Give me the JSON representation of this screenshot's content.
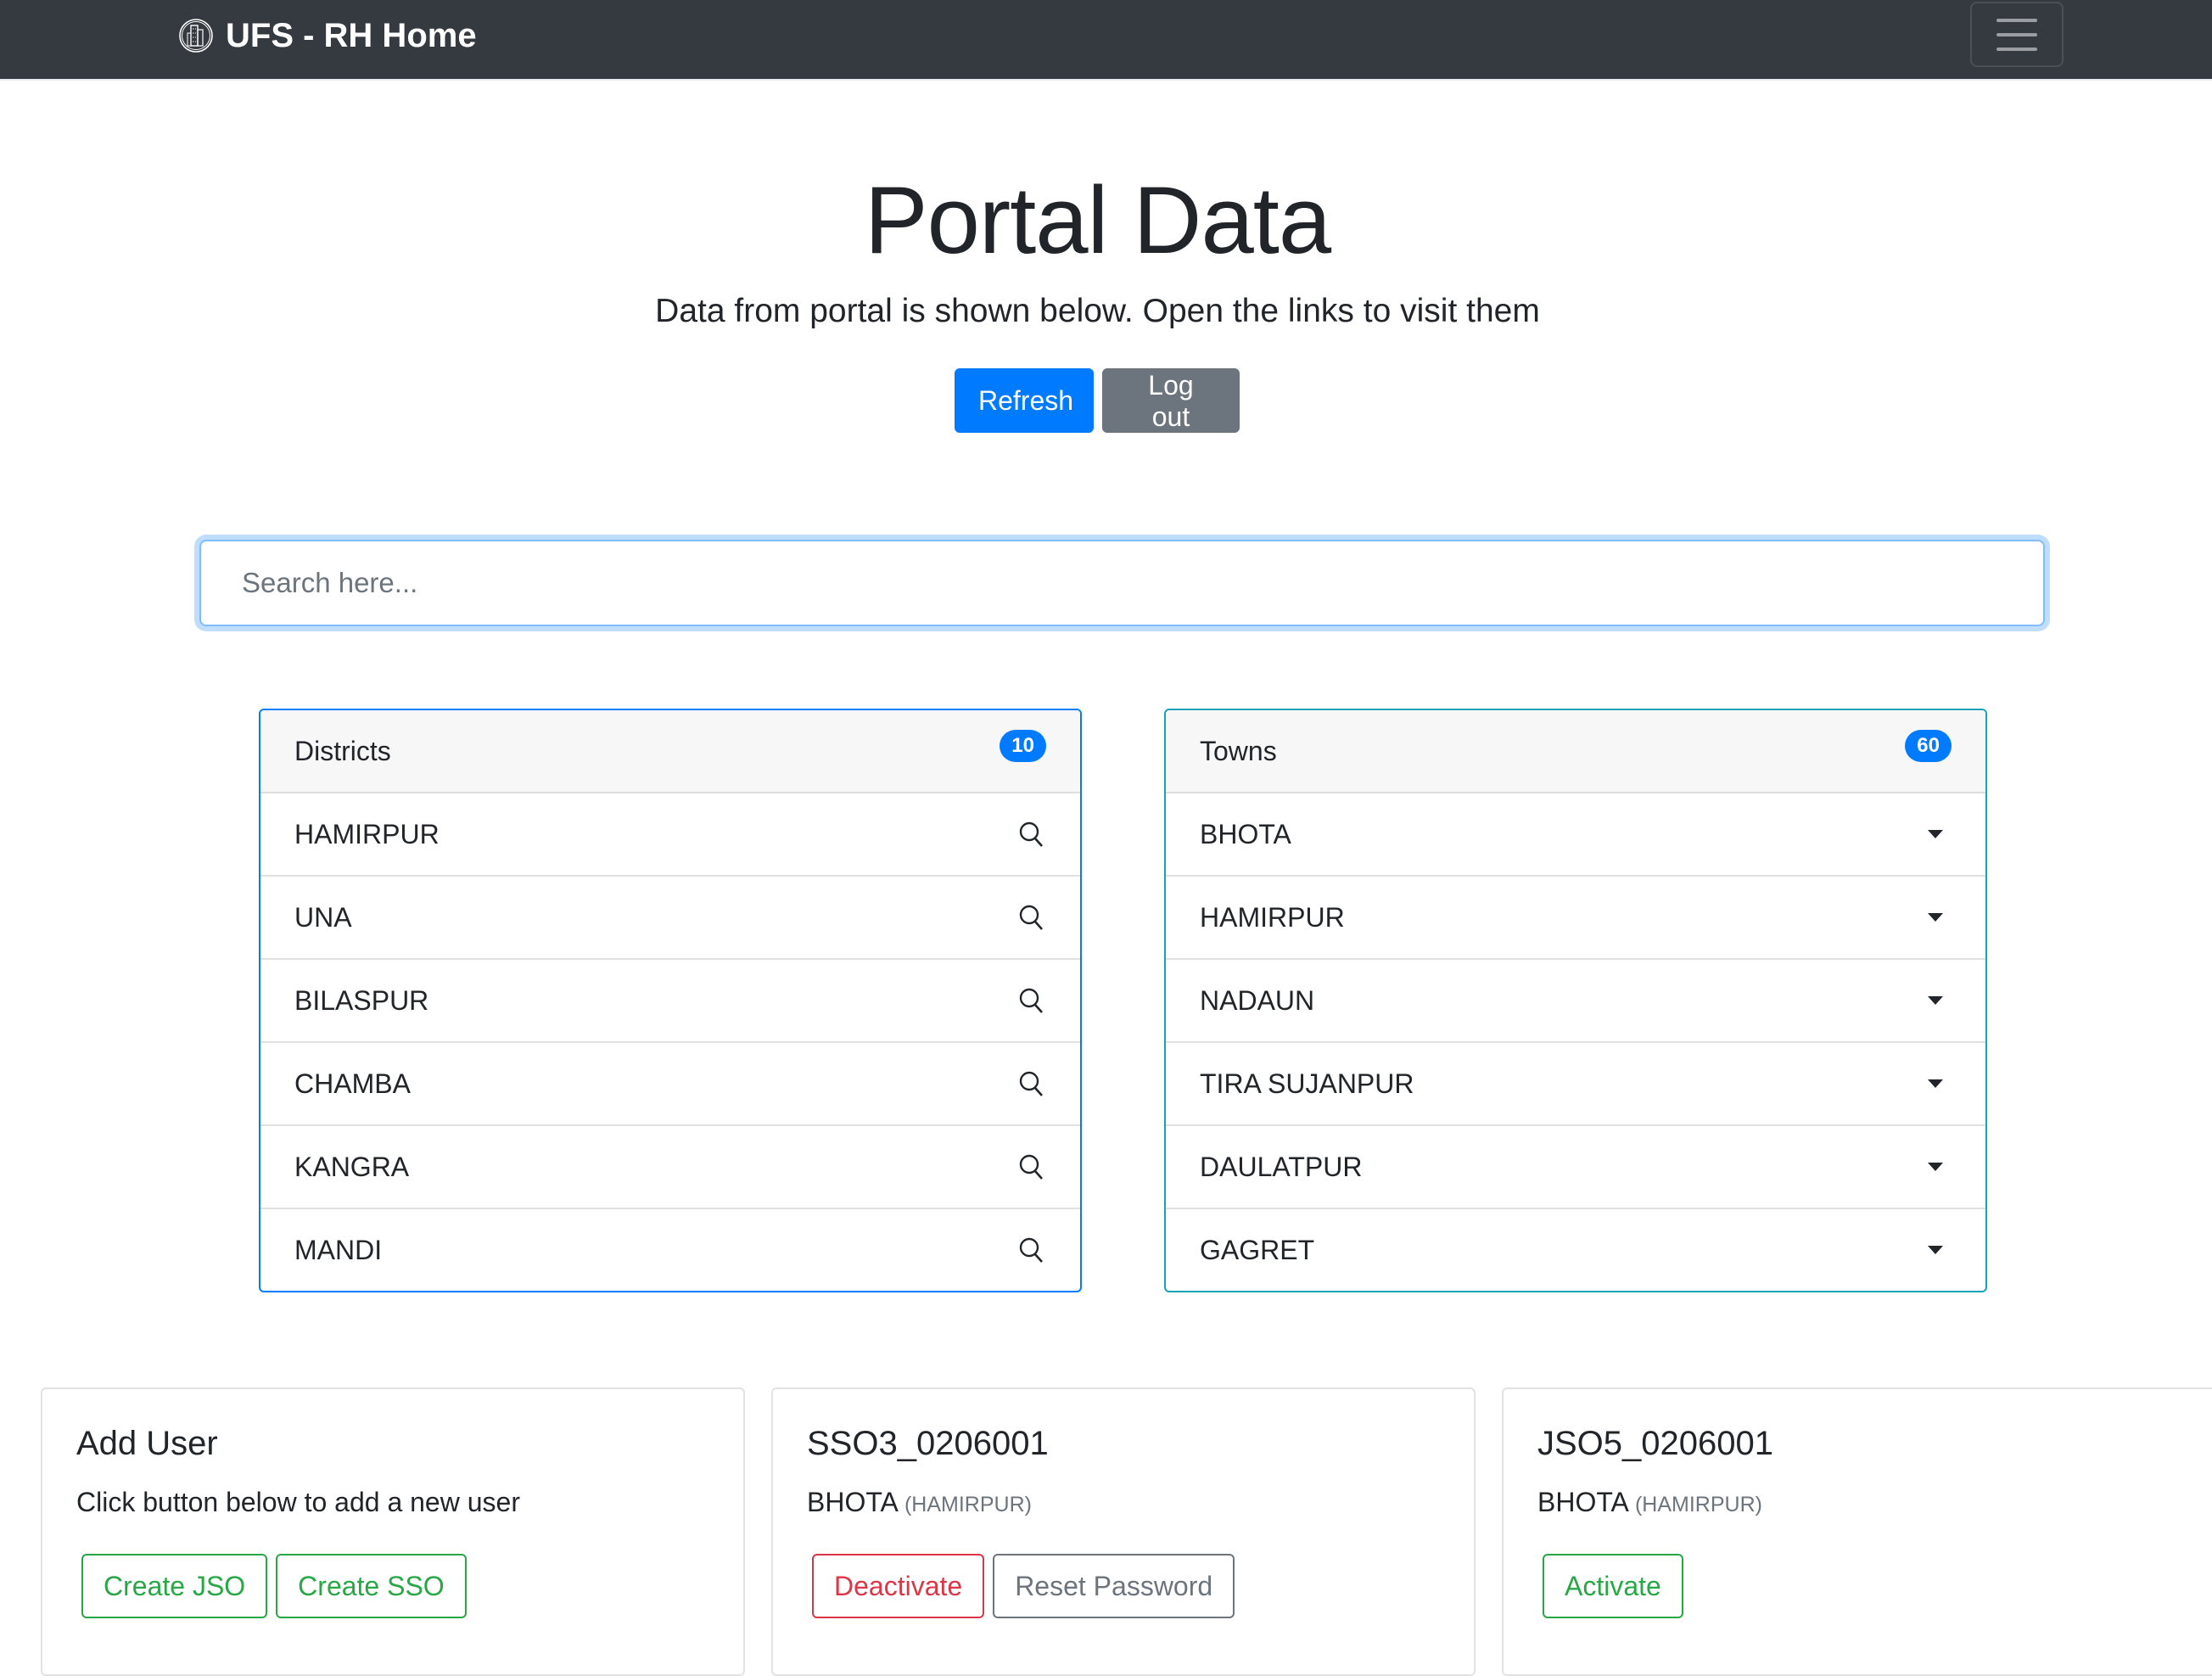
{
  "navbar": {
    "brand": "UFS - RH Home",
    "logo_icon": "building-logo-icon",
    "toggler_icon": "hamburger-menu-icon"
  },
  "hero": {
    "title": "Portal Data",
    "lead": "Data from portal is shown below. Open the links to visit them",
    "refresh_label": "Refresh",
    "logout_label": "Log out"
  },
  "search": {
    "placeholder": "Search here...",
    "value": ""
  },
  "districts": {
    "title": "Districts",
    "count": "10",
    "items": [
      "HAMIRPUR",
      "UNA",
      "BILASPUR",
      "CHAMBA",
      "KANGRA",
      "MANDI"
    ]
  },
  "towns": {
    "title": "Towns",
    "count": "60",
    "items": [
      "BHOTA",
      "HAMIRPUR",
      "NADAUN",
      "TIRA SUJANPUR",
      "DAULATPUR",
      "GAGRET"
    ]
  },
  "add_user": {
    "title": "Add User",
    "text": "Click button below to add a new user",
    "create_jso_label": "Create JSO",
    "create_sso_label": "Create SSO"
  },
  "users": [
    {
      "id": "SSO3_0206001",
      "town": "BHOTA",
      "district": "(HAMIRPUR)",
      "primary_action": "Deactivate",
      "secondary_action": "Reset Password"
    },
    {
      "id": "JSO5_0206001",
      "town": "BHOTA",
      "district": "(HAMIRPUR)",
      "primary_action": "Activate"
    }
  ],
  "colors": {
    "navbar": "#343a40",
    "primary": "#007bff",
    "secondary": "#6c757d",
    "success": "#28a745",
    "danger": "#dc3545",
    "info": "#17a2b8"
  }
}
